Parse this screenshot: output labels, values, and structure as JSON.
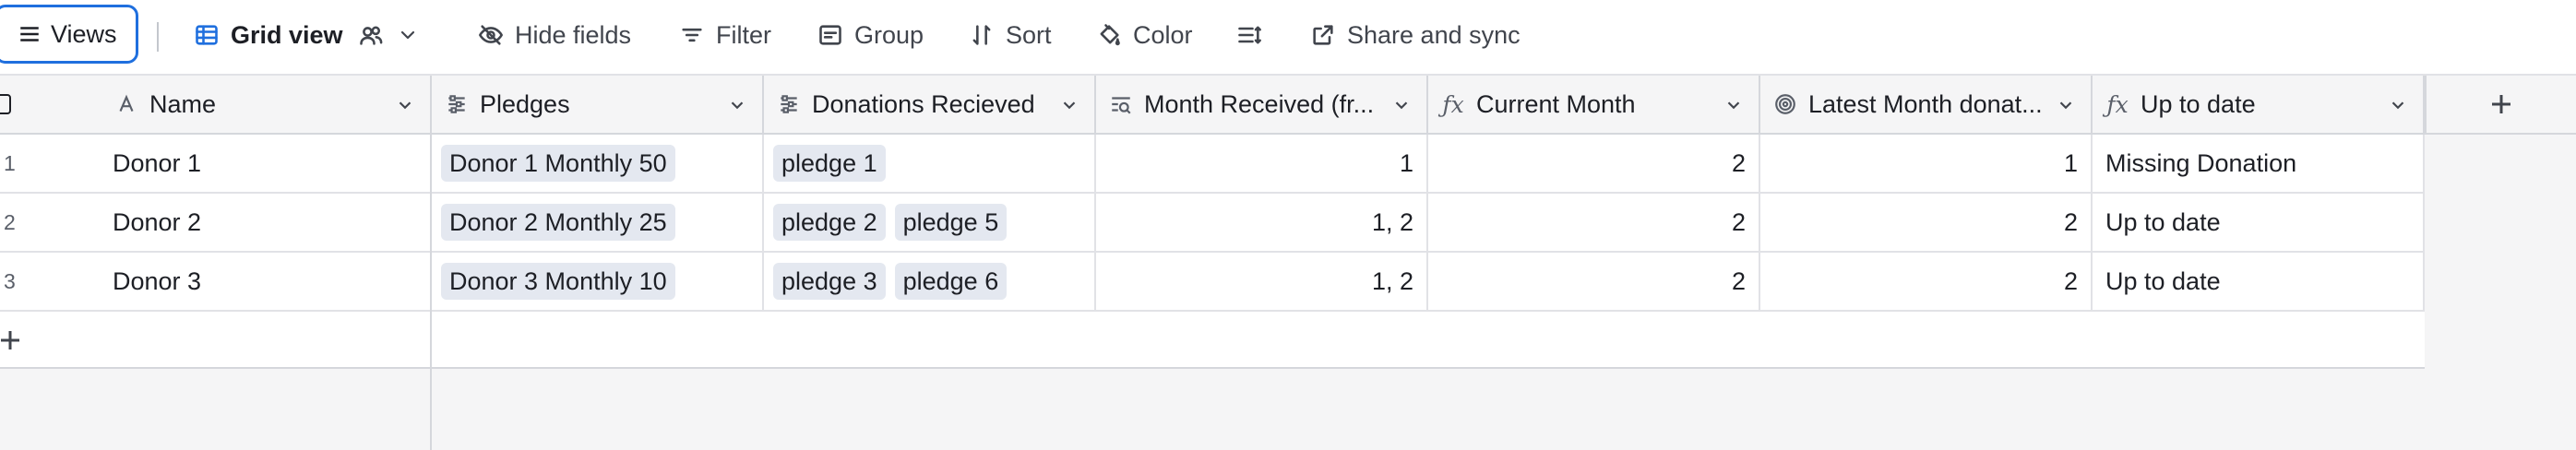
{
  "toolbar": {
    "views_label": "Views",
    "grid_view_label": "Grid view",
    "hide_fields_label": "Hide fields",
    "filter_label": "Filter",
    "group_label": "Group",
    "sort_label": "Sort",
    "color_label": "Color",
    "share_label": "Share and sync"
  },
  "columns": [
    {
      "label": "Name",
      "icon": "text-icon"
    },
    {
      "label": "Pledges",
      "icon": "link-records-icon"
    },
    {
      "label": "Donations Recieved",
      "icon": "link-records-icon"
    },
    {
      "label": "Month Received (fr...",
      "icon": "lookup-icon"
    },
    {
      "label": "Current Month",
      "icon": "formula-icon"
    },
    {
      "label": "Latest Month donat...",
      "icon": "rollup-icon"
    },
    {
      "label": "Up to date",
      "icon": "formula-icon"
    }
  ],
  "rows": [
    {
      "num": "1",
      "name": "Donor 1",
      "pledges": [
        "Donor 1 Monthly 50"
      ],
      "donations": [
        "pledge 1"
      ],
      "month_received": "1",
      "current_month": "2",
      "latest_month": "1",
      "up_to_date": "Missing Donation"
    },
    {
      "num": "2",
      "name": "Donor 2",
      "pledges": [
        "Donor 2 Monthly 25"
      ],
      "donations": [
        "pledge 2",
        "pledge 5"
      ],
      "month_received": "1, 2",
      "current_month": "2",
      "latest_month": "2",
      "up_to_date": "Up to date"
    },
    {
      "num": "3",
      "name": "Donor 3",
      "pledges": [
        "Donor 3 Monthly 10"
      ],
      "donations": [
        "pledge 3",
        "pledge 6"
      ],
      "month_received": "1, 2",
      "current_month": "2",
      "latest_month": "2",
      "up_to_date": "Up to date"
    }
  ],
  "colors": {
    "accent": "#1f6fde",
    "chip_bg": "#e4e8f0",
    "header_bg": "#f5f5f6"
  }
}
